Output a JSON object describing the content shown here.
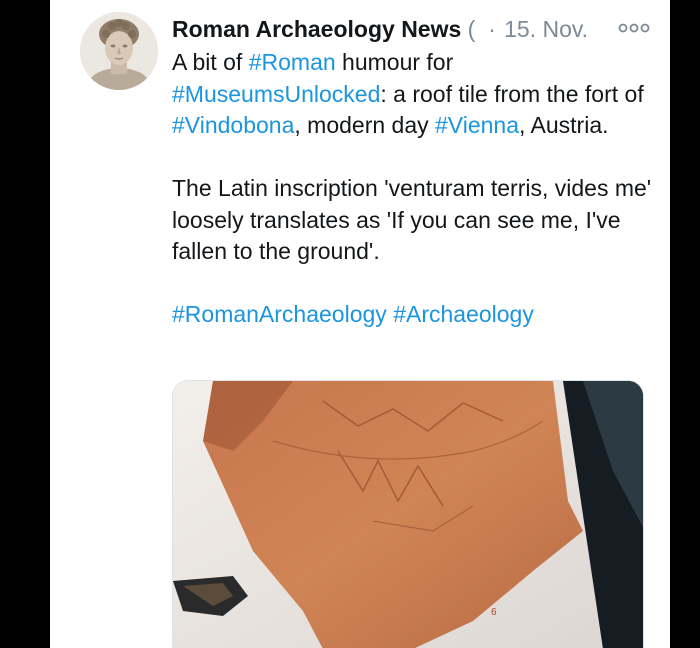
{
  "tweet": {
    "display_name": "Roman Archaeology News",
    "handle_fragment": "(",
    "separator": "·",
    "date": "15. Nov.",
    "text": {
      "p1_a": "A bit of ",
      "p1_tag1": "#Roman",
      "p1_b": " humour for",
      "p1_tag2": "#MuseumsUnlocked",
      "p1_c": ": a roof tile from the fort of ",
      "p1_tag3": "#Vindobona",
      "p1_d": ", modern day ",
      "p1_tag4": "#Vienna",
      "p1_e": ", Austria.",
      "p2": "The Latin inscription 'venturam terris, vides me' loosely translates as 'If you can see me, I've fallen to the ground'.",
      "tag5": "#RomanArchaeology",
      "tag6": "#Archaeology"
    },
    "media": {
      "exhibit_number": "6"
    }
  },
  "icons": {
    "avatar": "roman-bust-avatar",
    "more": "more-options-icon"
  },
  "colors": {
    "hashtag": "#1b95e0",
    "meta": "#7c8a96",
    "tile": "#c8744a"
  }
}
